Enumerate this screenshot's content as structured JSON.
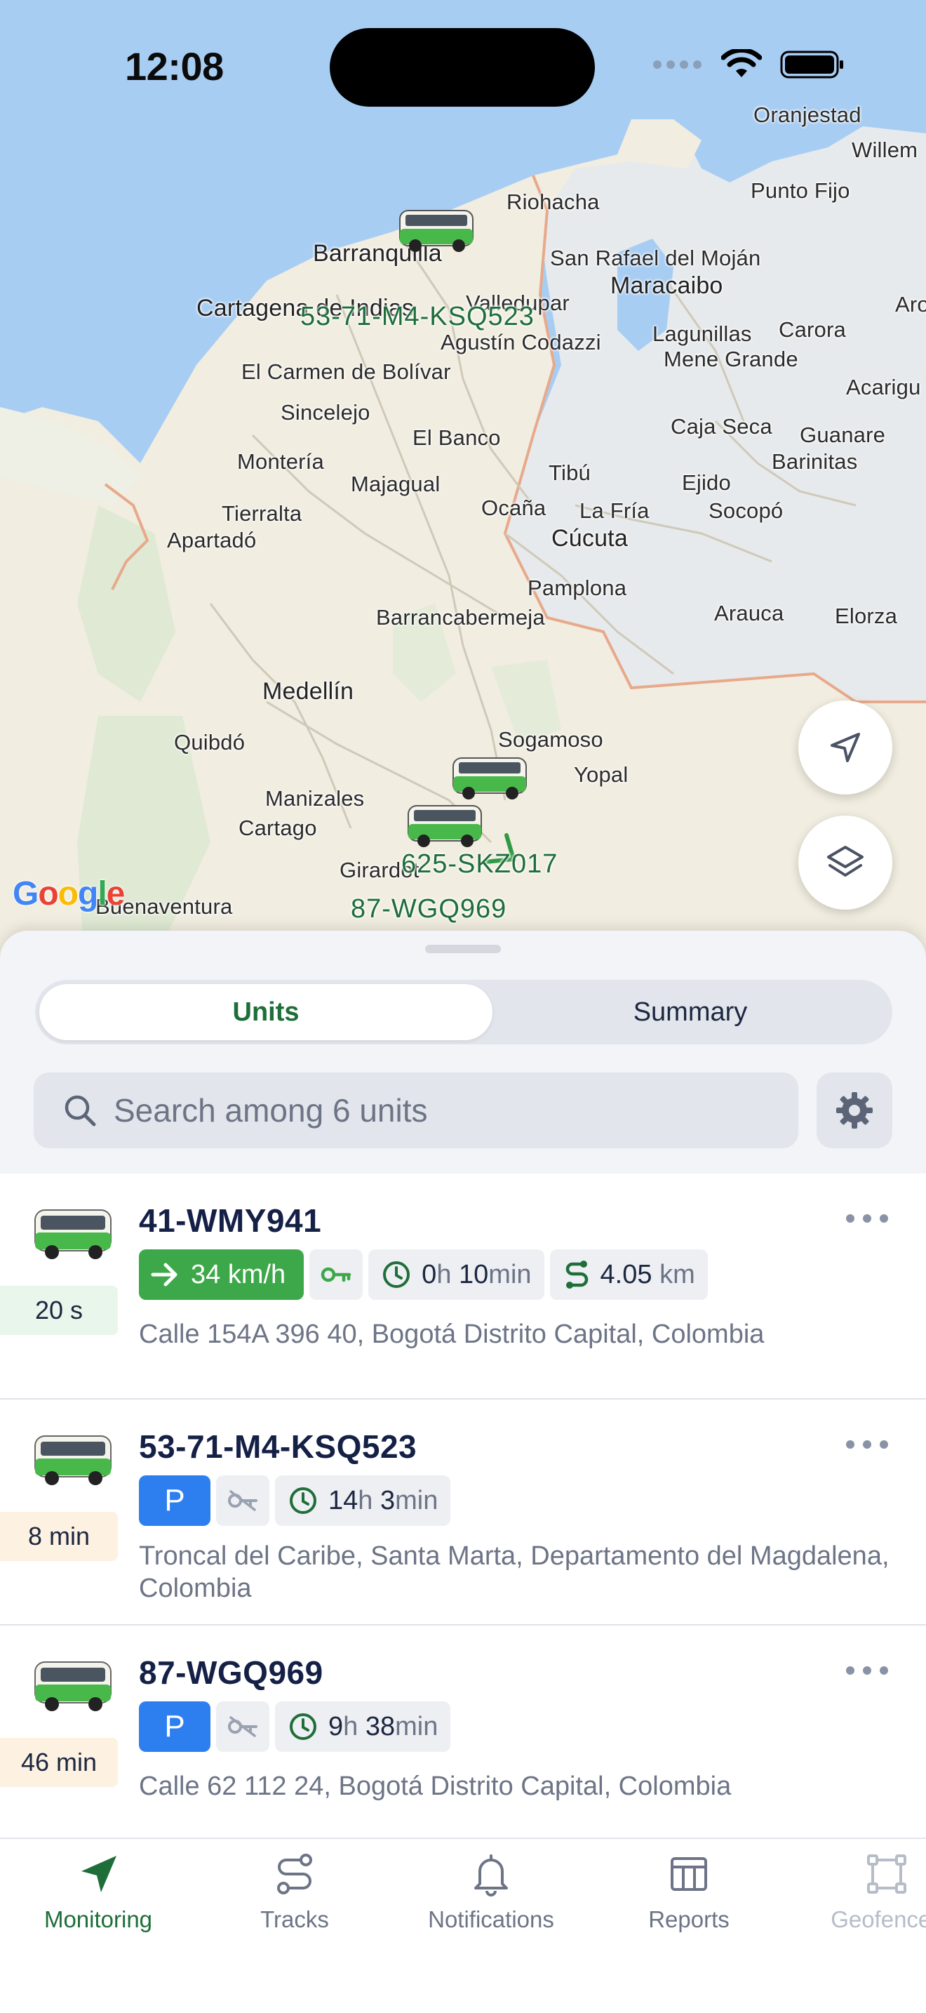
{
  "status_bar": {
    "time": "12:08"
  },
  "map": {
    "cities": [
      {
        "name": "Oranjestad"
      },
      {
        "name": "Willem"
      },
      {
        "name": "Punto Fijo"
      },
      {
        "name": "Riohacha"
      },
      {
        "name": "Barranquilla"
      },
      {
        "name": "San Rafael del Moján"
      },
      {
        "name": "Maracaibo"
      },
      {
        "name": "Cartagena de Indias"
      },
      {
        "name": "Valledupar"
      },
      {
        "name": "Agustín Codazzi"
      },
      {
        "name": "Lagunillas"
      },
      {
        "name": "Carora"
      },
      {
        "name": "Aro"
      },
      {
        "name": "Mene Grande"
      },
      {
        "name": "El Carmen de Bolívar"
      },
      {
        "name": "Acarigu"
      },
      {
        "name": "Sincelejo"
      },
      {
        "name": "Caja Seca"
      },
      {
        "name": "Guanare"
      },
      {
        "name": "El Banco"
      },
      {
        "name": "Montería"
      },
      {
        "name": "Barinitas"
      },
      {
        "name": "Majagual"
      },
      {
        "name": "Tibú"
      },
      {
        "name": "Ejido"
      },
      {
        "name": "Tierralta"
      },
      {
        "name": "Ocaña"
      },
      {
        "name": "La Fría"
      },
      {
        "name": "Socopó"
      },
      {
        "name": "Apartadó"
      },
      {
        "name": "Cúcuta"
      },
      {
        "name": "Pamplona"
      },
      {
        "name": "Arauca"
      },
      {
        "name": "Elorza"
      },
      {
        "name": "Barrancabermeja"
      },
      {
        "name": "Medellín"
      },
      {
        "name": "Sogamoso"
      },
      {
        "name": "Quibdó"
      },
      {
        "name": "Yopal"
      },
      {
        "name": "Manizales"
      },
      {
        "name": "Cartago"
      },
      {
        "name": "Girardot"
      },
      {
        "name": "Buenaventura"
      }
    ],
    "unit_labels": [
      "53-71-M4-KSQ523",
      "625-SKZ017",
      "87-WGQ969"
    ],
    "provider": "Google"
  },
  "tabs": {
    "units": "Units",
    "summary": "Summary"
  },
  "search": {
    "placeholder": "Search among 6 units"
  },
  "units": [
    {
      "name": "41-WMY941",
      "age": "20 s",
      "speed": "34 km/h",
      "duration": {
        "h": "0",
        "h_unit": "h",
        "m": "10",
        "m_unit": "min"
      },
      "distance": {
        "value": "4.05",
        "unit": "km"
      },
      "address": "Calle 154A 396 40, Bogotá Distrito Capital, Colombia"
    },
    {
      "name": "53-71-M4-KSQ523",
      "age": "8 min",
      "parking": "P",
      "duration": {
        "h": "14",
        "h_unit": "h",
        "m": "3",
        "m_unit": "min"
      },
      "address": "Troncal del Caribe, Santa Marta, Departamento del Magdalena, Colombia"
    },
    {
      "name": "87-WGQ969",
      "age": "46 min",
      "parking": "P",
      "duration": {
        "h": "9",
        "h_unit": "h",
        "m": "38",
        "m_unit": "min"
      },
      "address": "Calle 62 112 24, Bogotá Distrito Capital, Colombia"
    }
  ],
  "nav": {
    "monitoring": "Monitoring",
    "tracks": "Tracks",
    "notifications": "Notifications",
    "reports": "Reports",
    "geofences": "Geofences"
  },
  "colors": {
    "accent": "#1f6e3a",
    "speed_chip": "#3da84a",
    "parking_chip": "#2d7ff0",
    "sea": "#a8cdf3"
  }
}
